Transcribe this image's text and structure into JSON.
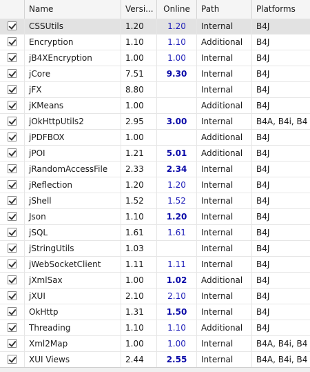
{
  "columns": [
    "",
    "Name",
    "Versi...",
    "Online",
    "Path",
    "Platforms"
  ],
  "rows": [
    {
      "name": "CSSUtils",
      "version": "1.20",
      "online": "1.20",
      "online_bold": false,
      "path": "Internal",
      "platforms": "B4J",
      "selected": true
    },
    {
      "name": "Encryption",
      "version": "1.10",
      "online": "1.10",
      "online_bold": false,
      "path": "Additional",
      "platforms": "B4J"
    },
    {
      "name": "jB4XEncryption",
      "version": "1.00",
      "online": "1.00",
      "online_bold": false,
      "path": "Internal",
      "platforms": "B4J"
    },
    {
      "name": "jCore",
      "version": "7.51",
      "online": "9.30",
      "online_bold": true,
      "path": "Internal",
      "platforms": "B4J"
    },
    {
      "name": "jFX",
      "version": "8.80",
      "online": "",
      "online_bold": false,
      "path": "Internal",
      "platforms": "B4J"
    },
    {
      "name": "jKMeans",
      "version": "1.00",
      "online": "",
      "online_bold": false,
      "path": "Additional",
      "platforms": "B4J"
    },
    {
      "name": "jOkHttpUtils2",
      "version": "2.95",
      "online": "3.00",
      "online_bold": true,
      "path": "Internal",
      "platforms": "B4A, B4i, B4"
    },
    {
      "name": "jPDFBOX",
      "version": "1.00",
      "online": "",
      "online_bold": false,
      "path": "Additional",
      "platforms": "B4J"
    },
    {
      "name": "jPOI",
      "version": "1.21",
      "online": "5.01",
      "online_bold": true,
      "path": "Additional",
      "platforms": "B4J"
    },
    {
      "name": "jRandomAccessFile",
      "version": "2.33",
      "online": "2.34",
      "online_bold": true,
      "path": "Internal",
      "platforms": "B4J"
    },
    {
      "name": "jReflection",
      "version": "1.20",
      "online": "1.20",
      "online_bold": false,
      "path": "Internal",
      "platforms": "B4J"
    },
    {
      "name": "jShell",
      "version": "1.52",
      "online": "1.52",
      "online_bold": false,
      "path": "Internal",
      "platforms": "B4J"
    },
    {
      "name": "Json",
      "version": "1.10",
      "online": "1.20",
      "online_bold": true,
      "path": "Internal",
      "platforms": "B4J"
    },
    {
      "name": "jSQL",
      "version": "1.61",
      "online": "1.61",
      "online_bold": false,
      "path": "Internal",
      "platforms": "B4J"
    },
    {
      "name": "jStringUtils",
      "version": "1.03",
      "online": "",
      "online_bold": false,
      "path": "Internal",
      "platforms": "B4J"
    },
    {
      "name": "jWebSocketClient",
      "version": "1.11",
      "online": "1.11",
      "online_bold": false,
      "path": "Internal",
      "platforms": "B4J"
    },
    {
      "name": "jXmlSax",
      "version": "1.00",
      "online": "1.02",
      "online_bold": true,
      "path": "Additional",
      "platforms": "B4J"
    },
    {
      "name": "jXUI",
      "version": "2.10",
      "online": "2.10",
      "online_bold": false,
      "path": "Internal",
      "platforms": "B4J"
    },
    {
      "name": "OkHttp",
      "version": "1.31",
      "online": "1.50",
      "online_bold": true,
      "path": "Internal",
      "platforms": "B4J"
    },
    {
      "name": "Threading",
      "version": "1.10",
      "online": "1.10",
      "online_bold": false,
      "path": "Additional",
      "platforms": "B4J"
    },
    {
      "name": "Xml2Map",
      "version": "1.00",
      "online": "1.00",
      "online_bold": false,
      "path": "Internal",
      "platforms": "B4A, B4i, B4"
    },
    {
      "name": "XUI Views",
      "version": "2.44",
      "online": "2.55",
      "online_bold": true,
      "path": "Internal",
      "platforms": "B4A, B4i, B4"
    }
  ],
  "icons": {
    "search_icon": "magnifier-icon",
    "checkbox": "checked"
  }
}
